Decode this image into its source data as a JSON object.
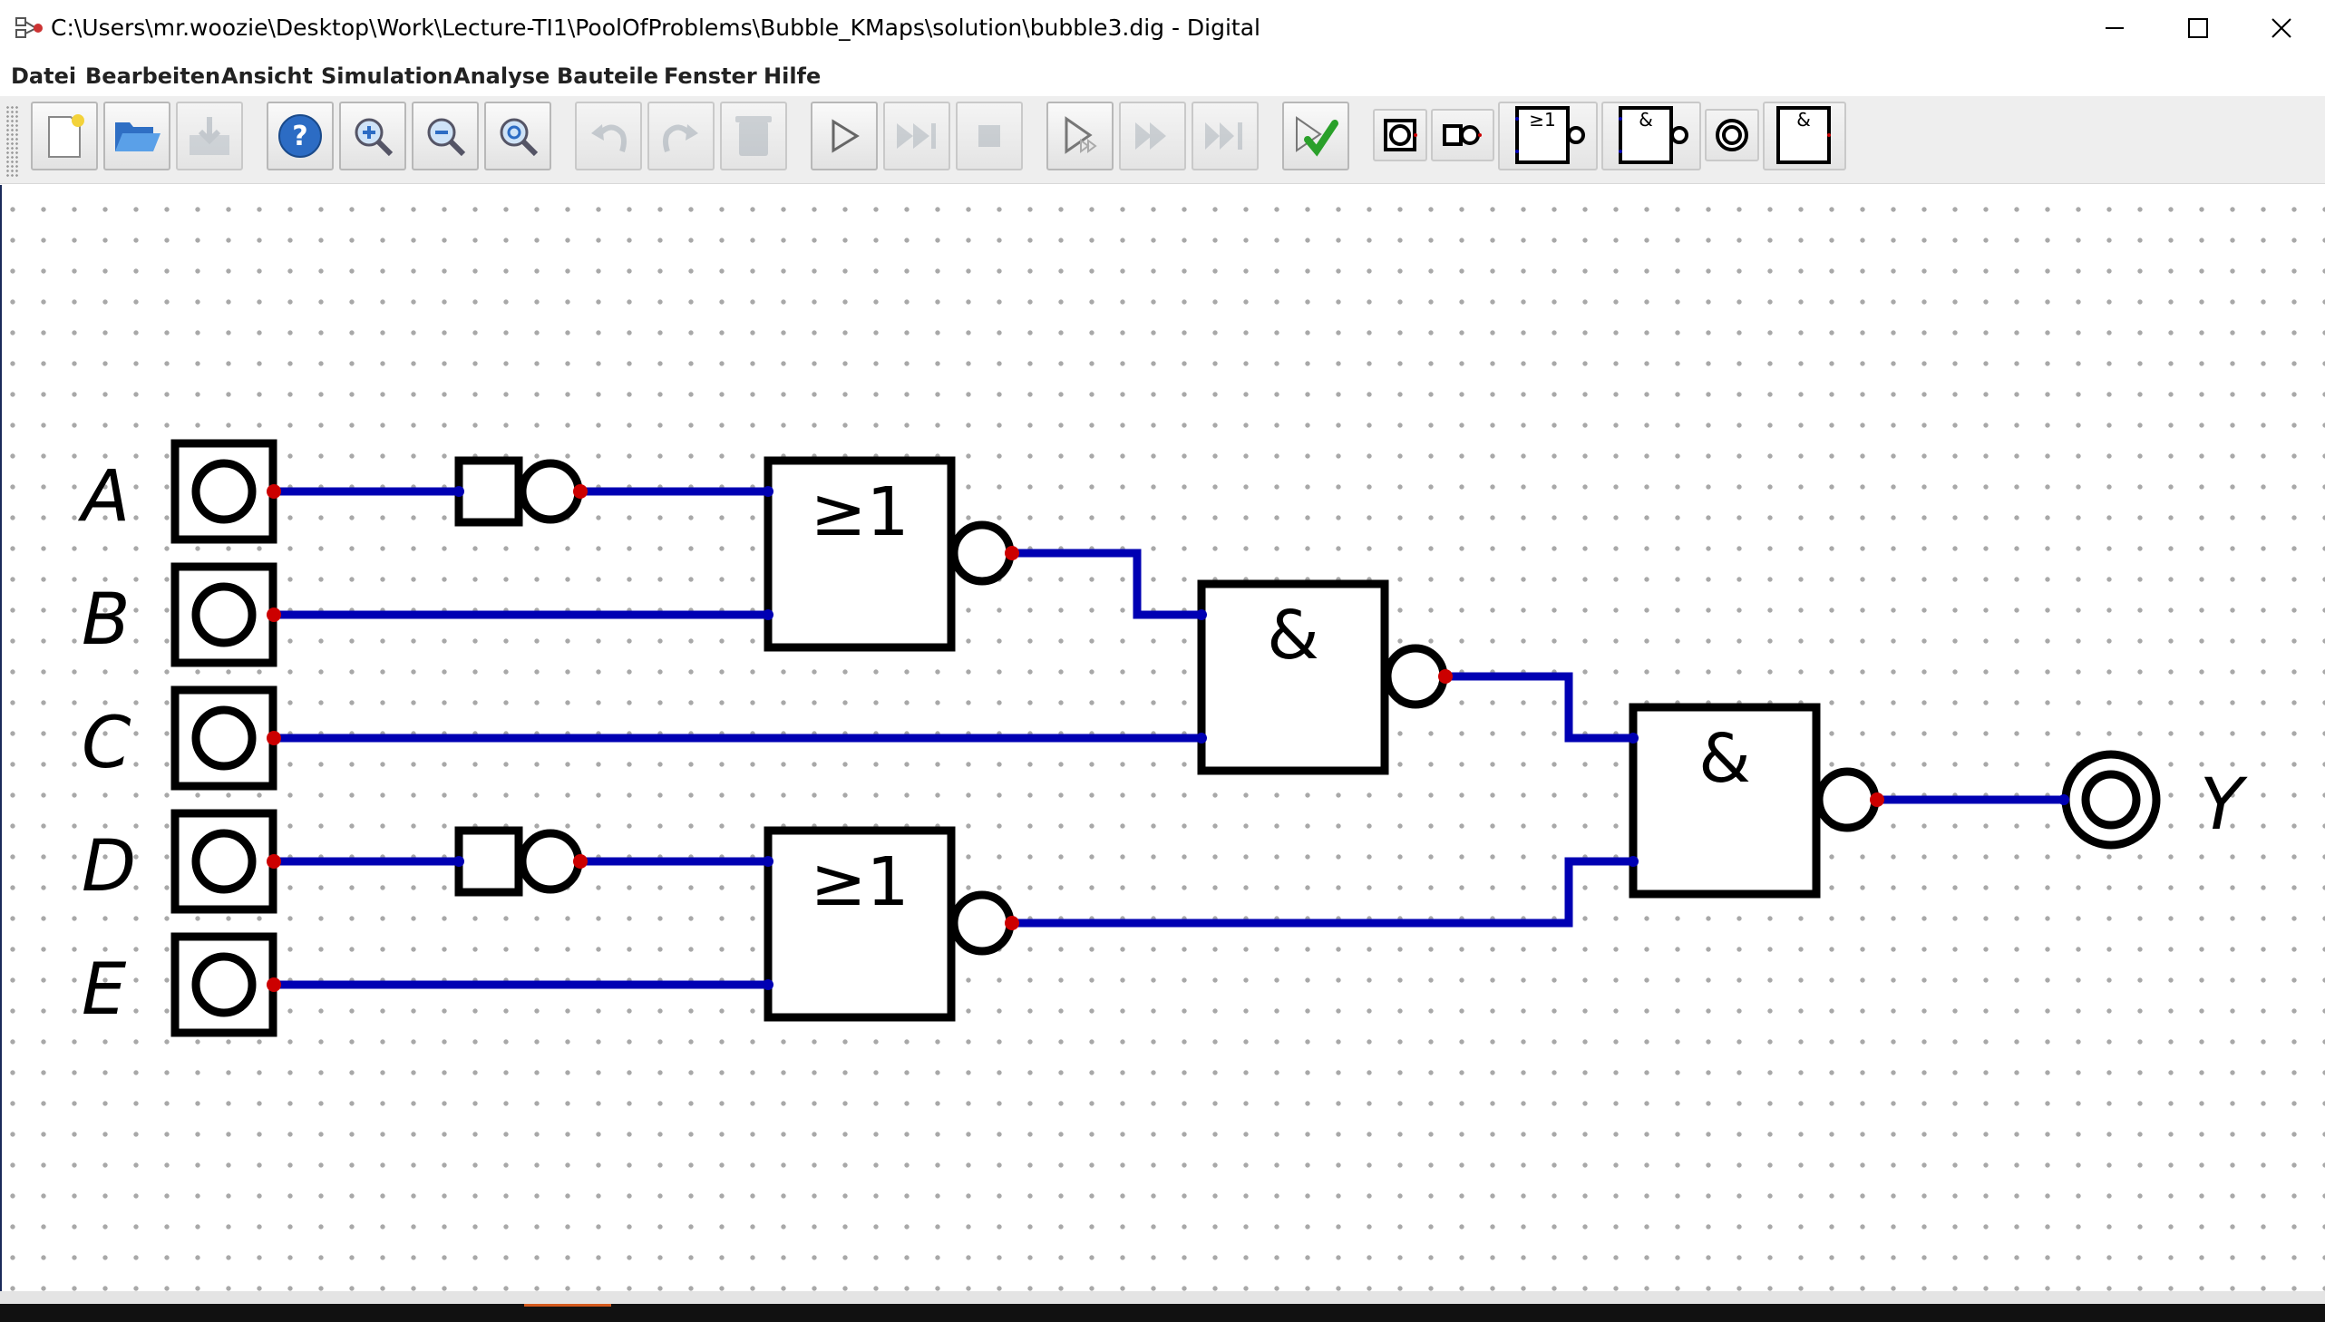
{
  "window": {
    "title": "C:\\Users\\mr.woozie\\Desktop\\Work\\Lecture-TI1\\PoolOfProblems\\Bubble_KMaps\\solution\\bubble3.dig - Digital"
  },
  "menu": {
    "items": [
      "Datei",
      "Bearbeiten",
      "Ansicht",
      "Simulation",
      "Analyse",
      "Bauteile",
      "Fenster",
      "Hilfe"
    ]
  },
  "toolbar": {
    "buttons": [
      {
        "name": "new-icon",
        "enabled": true
      },
      {
        "name": "open-folder-icon",
        "enabled": true
      },
      {
        "name": "save-icon",
        "enabled": false
      },
      {
        "name": "help-icon",
        "enabled": true
      },
      {
        "name": "zoom-in-icon",
        "enabled": true
      },
      {
        "name": "zoom-out-icon",
        "enabled": true
      },
      {
        "name": "zoom-fit-icon",
        "enabled": true
      },
      {
        "name": "undo-icon",
        "enabled": false
      },
      {
        "name": "redo-icon",
        "enabled": false
      },
      {
        "name": "delete-icon",
        "enabled": false
      },
      {
        "name": "play-icon",
        "enabled": true
      },
      {
        "name": "fast-forward-icon",
        "enabled": false
      },
      {
        "name": "stop-icon",
        "enabled": false
      },
      {
        "name": "step-icon",
        "enabled": true
      },
      {
        "name": "step-double-icon",
        "enabled": false
      },
      {
        "name": "step-end-icon",
        "enabled": false
      },
      {
        "name": "test-check-icon",
        "enabled": true
      }
    ],
    "recent_parts": [
      {
        "name": "recent-input-part",
        "label": ""
      },
      {
        "name": "recent-not-part",
        "label": ""
      },
      {
        "name": "recent-nor-part",
        "label": "≥1"
      },
      {
        "name": "recent-nand-part",
        "label": "&"
      },
      {
        "name": "recent-output-part",
        "label": ""
      },
      {
        "name": "recent-and-part",
        "label": "&"
      }
    ]
  },
  "circuit": {
    "inputs": [
      "A",
      "B",
      "C",
      "D",
      "E"
    ],
    "output": "Y",
    "gates": {
      "nor_top": "≥1",
      "nor_bottom": "≥1",
      "nand_middle": "&",
      "nand_final": "&"
    }
  },
  "colors": {
    "wire": "#0000b3",
    "pin": "#cc0000",
    "component": "#000000"
  }
}
